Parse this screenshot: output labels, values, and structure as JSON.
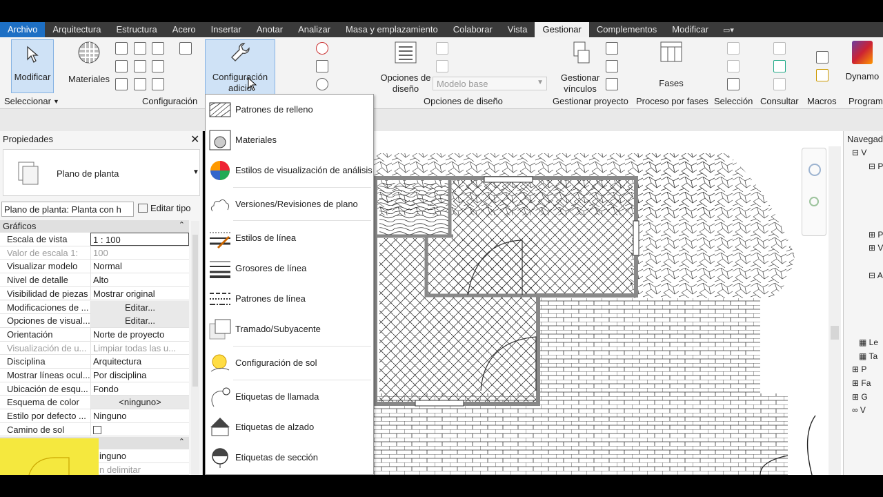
{
  "tabs": [
    "Archivo",
    "Arquitectura",
    "Estructura",
    "Acero",
    "Insertar",
    "Anotar",
    "Analizar",
    "Masa y emplazamiento",
    "Colaborar",
    "Vista",
    "Gestionar",
    "Complementos",
    "Modificar"
  ],
  "active_tab": "Gestionar",
  "ribbon": {
    "modify_label": "Modificar",
    "materials_label": "Materiales",
    "config_label_1": "Configuración",
    "config_label_2": "adicio",
    "design_options_1": "Opciones de",
    "design_options_2": "diseño",
    "base_model": "Modelo base",
    "manage_links_1": "Gestionar",
    "manage_links_2": "vínculos",
    "phases_label": "Fases",
    "dynamo_label": "Dynamo",
    "panels": {
      "select": "Seleccionar",
      "config": "Configuración",
      "design_options": "Opciones de diseño",
      "manage_project": "Gestionar proyecto",
      "phasing": "Proceso por fases",
      "selection": "Selección",
      "inquiry": "Consultar",
      "macros": "Macros",
      "visual_programming": "Program"
    }
  },
  "menu": {
    "items": [
      "Patrones de relleno",
      "Materiales",
      "Estilos de visualización de análisis",
      "Versiones/Revisiones de plano",
      "Estilos de línea",
      "Grosores de línea",
      "Patrones de línea",
      "Tramado/Subyacente",
      "Configuración de sol",
      "Etiquetas de llamada",
      "Etiquetas de alzado",
      "Etiquetas de sección"
    ]
  },
  "properties": {
    "title": "Propiedades",
    "type_name": "Plano de planta",
    "instance_select": "Plano de planta: Planta con h",
    "edit_type": "Editar tipo",
    "group_graphics": "Gráficos",
    "rows": [
      {
        "k": "Escala de vista",
        "v": "1 : 100"
      },
      {
        "k": "Valor de escala    1:",
        "v": "100"
      },
      {
        "k": "Visualizar modelo",
        "v": "Normal"
      },
      {
        "k": "Nivel de detalle",
        "v": "Alto"
      },
      {
        "k": "Visibilidad de piezas",
        "v": "Mostrar original"
      },
      {
        "k": "Modificaciones de ...",
        "v": "Editar..."
      },
      {
        "k": "Opciones de visual...",
        "v": "Editar..."
      },
      {
        "k": "Orientación",
        "v": "Norte de proyecto"
      },
      {
        "k": "Visualización de u...",
        "v": "Limpiar todas las u..."
      },
      {
        "k": "Disciplina",
        "v": "Arquitectura"
      },
      {
        "k": "Mostrar líneas ocul...",
        "v": "Por disciplina"
      },
      {
        "k": "Ubicación de esqu...",
        "v": "Fondo"
      },
      {
        "k": "Esquema de color",
        "v": "<ninguno>"
      },
      {
        "k": "Estilo por defecto ...",
        "v": "Ninguno"
      },
      {
        "k": "Camino de sol",
        "v": ""
      }
    ],
    "extra_1": "inguno",
    "extra_2": "n delimitar"
  },
  "browser": {
    "title": "Navegad",
    "items": [
      "V",
      "P",
      "P",
      "V",
      "A",
      "Le",
      "Ta",
      "P",
      "Fa",
      "G",
      "V"
    ]
  }
}
